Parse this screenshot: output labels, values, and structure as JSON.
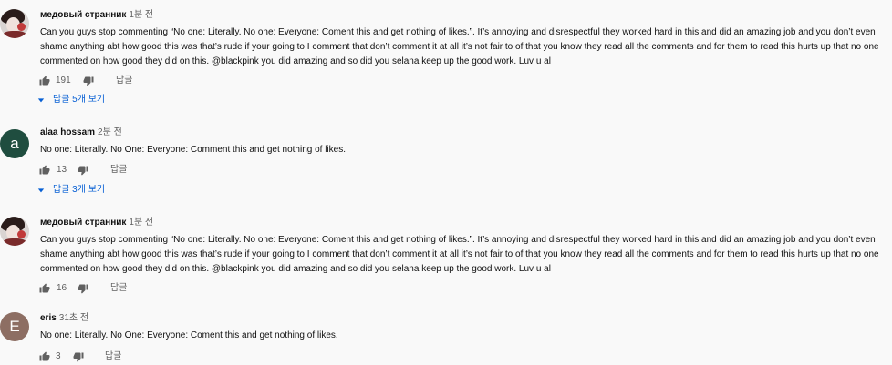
{
  "comments": [
    {
      "author": "медовый странник",
      "time": "1분 전",
      "avatar": "photo",
      "text": "Can you guys stop commenting “No one: Literally. No one: Everyone: Coment this and get nothing of likes.”. It’s annoying and disrespectful they worked hard in this and did an amazing job and you don’t even shame anything abt how good this was that’s rude if your going to I comment that don’t comment it at all it’s not fair to of that you know they read all the comments and for them to read this hurts up that no one commented on how good they did on this. @blackpink you did amazing and so did you selana keep up the good work. Luv u al",
      "likes": "191",
      "reply_label": "답글",
      "replies_label": "답글 5개 보기"
    },
    {
      "author": "alaa hossam",
      "time": "2분 전",
      "avatar": "a",
      "avatar_color": "#1f4d3f",
      "text": "No one: Literally. No One: Everyone: Comment this and get nothing of likes.",
      "likes": "13",
      "reply_label": "답글",
      "replies_label": "답글 3개 보기"
    },
    {
      "author": "медовый странник",
      "time": "1분 전",
      "avatar": "photo",
      "text": "Can you guys stop commenting “No one: Literally. No one: Everyone: Coment this and get nothing of likes.”. It’s annoying and disrespectful they worked hard in this and did an amazing job and you don’t even shame anything abt how good this was that’s rude if your going to I comment that don’t comment it at all it’s not fair to of that you know they read all the comments and for them to read this hurts up that no one commented on how good they did on this. @blackpink you did amazing and so did you selana keep up the good work. Luv u al",
      "likes": "16",
      "reply_label": "답글"
    },
    {
      "author": "eris",
      "time": "31초 전",
      "avatar": "E",
      "avatar_color": "#8d6e63",
      "text": "No one: Literally. No One: Everyone: Coment this and get nothing of likes.",
      "likes": "3",
      "reply_label": "답글"
    }
  ],
  "colors": {
    "text": "#0f0f0f",
    "secondary": "#606060",
    "link": "#065fd4",
    "background": "#f9f9f9"
  },
  "icons": {
    "like": "thumb-up-icon",
    "dislike": "thumb-down-icon",
    "expand": "caret-down-icon"
  }
}
